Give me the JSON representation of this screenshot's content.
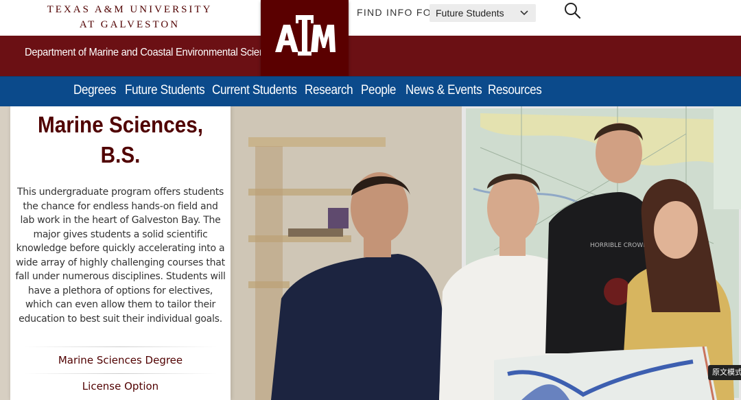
{
  "header": {
    "university_line1": "TEXAS A&M UNIVERSITY",
    "university_line2": "AT GALVESTON",
    "department": "Department of Marine and Coastal Environmental Science",
    "logo_text": "ATM",
    "find_info_label": "FIND INFO FOR:",
    "find_info_selected": "Future Students",
    "search_icon": "search-icon"
  },
  "nav": {
    "items": [
      {
        "label": "Degrees"
      },
      {
        "label": "Future Students"
      },
      {
        "label": "Current Students"
      },
      {
        "label": "Research"
      },
      {
        "label": "People"
      },
      {
        "label": "News & Events"
      },
      {
        "label": "Resources"
      }
    ]
  },
  "hero": {
    "title_line1": "Marine Sciences,",
    "title_line2": "B.S.",
    "description": "This undergraduate program offers students the chance for endless hands-on field and lab work in the heart of Galveston Bay. The major gives students a solid scientific knowledge before quickly accelerating into a wide array of highly challenging courses that fall under numerous disciplines. Students will have a plethora of options for electives, which can even allow them to tailor their education to best suit their individual goals.",
    "links": [
      {
        "label": "Marine Sciences Degree"
      },
      {
        "label": "License Option"
      }
    ],
    "shirt_text": "HORRIBLE CROWES"
  },
  "overlay_badge": "原文模式",
  "colors": {
    "maroon": "#500000",
    "header_band": "#6b1014",
    "nav_blue": "#0b4a8b"
  }
}
